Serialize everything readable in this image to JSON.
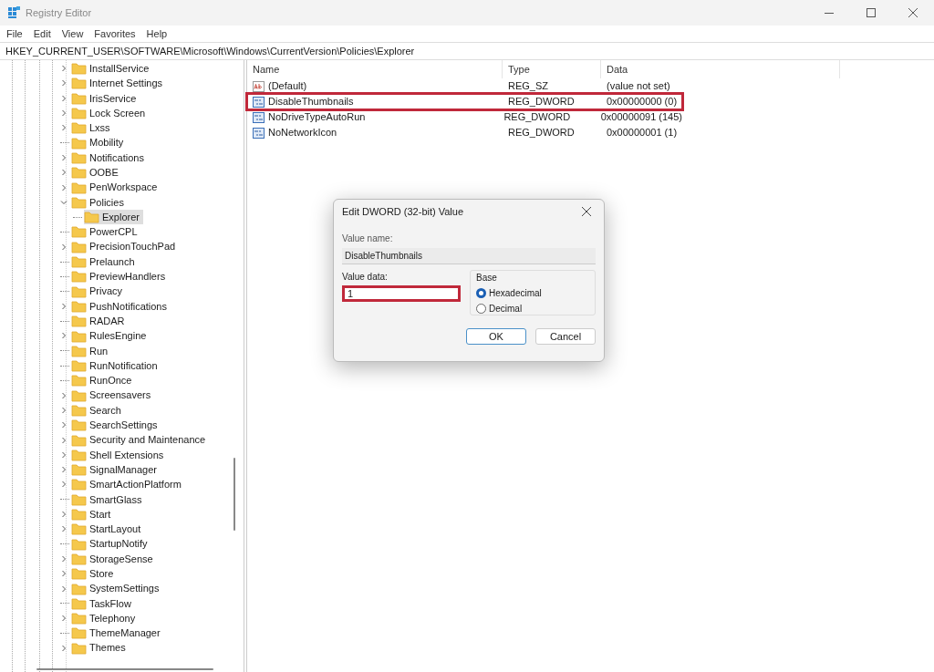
{
  "window": {
    "title": "Registry Editor"
  },
  "menu": [
    "File",
    "Edit",
    "View",
    "Favorites",
    "Help"
  ],
  "address": "HKEY_CURRENT_USER\\SOFTWARE\\Microsoft\\Windows\\CurrentVersion\\Policies\\Explorer",
  "tree": [
    {
      "label": "InstallService",
      "kind": "branch",
      "expanded": false,
      "selected": false
    },
    {
      "label": "Internet Settings",
      "kind": "branch",
      "expanded": false,
      "selected": false
    },
    {
      "label": "IrisService",
      "kind": "branch",
      "expanded": false,
      "selected": false
    },
    {
      "label": "Lock Screen",
      "kind": "branch",
      "expanded": false,
      "selected": false
    },
    {
      "label": "Lxss",
      "kind": "branch",
      "expanded": false,
      "selected": false
    },
    {
      "label": "Mobility",
      "kind": "leaf",
      "selected": false
    },
    {
      "label": "Notifications",
      "kind": "branch",
      "expanded": false,
      "selected": false
    },
    {
      "label": "OOBE",
      "kind": "branch",
      "expanded": false,
      "selected": false
    },
    {
      "label": "PenWorkspace",
      "kind": "branch",
      "expanded": false,
      "selected": false
    },
    {
      "label": "Policies",
      "kind": "branch",
      "expanded": true,
      "selected": false,
      "children": [
        {
          "label": "Explorer",
          "kind": "leaf",
          "selected": true
        }
      ]
    },
    {
      "label": "PowerCPL",
      "kind": "leaf",
      "selected": false
    },
    {
      "label": "PrecisionTouchPad",
      "kind": "branch",
      "expanded": false,
      "selected": false
    },
    {
      "label": "Prelaunch",
      "kind": "leaf",
      "selected": false
    },
    {
      "label": "PreviewHandlers",
      "kind": "leaf",
      "selected": false
    },
    {
      "label": "Privacy",
      "kind": "leaf",
      "selected": false
    },
    {
      "label": "PushNotifications",
      "kind": "branch",
      "expanded": false,
      "selected": false
    },
    {
      "label": "RADAR",
      "kind": "leaf",
      "selected": false
    },
    {
      "label": "RulesEngine",
      "kind": "branch",
      "expanded": false,
      "selected": false
    },
    {
      "label": "Run",
      "kind": "leaf",
      "selected": false
    },
    {
      "label": "RunNotification",
      "kind": "leaf",
      "selected": false
    },
    {
      "label": "RunOnce",
      "kind": "leaf",
      "selected": false
    },
    {
      "label": "Screensavers",
      "kind": "branch",
      "expanded": false,
      "selected": false
    },
    {
      "label": "Search",
      "kind": "branch",
      "expanded": false,
      "selected": false
    },
    {
      "label": "SearchSettings",
      "kind": "branch",
      "expanded": false,
      "selected": false
    },
    {
      "label": "Security and Maintenance",
      "kind": "branch",
      "expanded": false,
      "selected": false
    },
    {
      "label": "Shell Extensions",
      "kind": "branch",
      "expanded": false,
      "selected": false
    },
    {
      "label": "SignalManager",
      "kind": "branch",
      "expanded": false,
      "selected": false
    },
    {
      "label": "SmartActionPlatform",
      "kind": "branch",
      "expanded": false,
      "selected": false
    },
    {
      "label": "SmartGlass",
      "kind": "leaf",
      "selected": false
    },
    {
      "label": "Start",
      "kind": "branch",
      "expanded": false,
      "selected": false
    },
    {
      "label": "StartLayout",
      "kind": "branch",
      "expanded": false,
      "selected": false
    },
    {
      "label": "StartupNotify",
      "kind": "leaf",
      "selected": false
    },
    {
      "label": "StorageSense",
      "kind": "branch",
      "expanded": false,
      "selected": false
    },
    {
      "label": "Store",
      "kind": "branch",
      "expanded": false,
      "selected": false
    },
    {
      "label": "SystemSettings",
      "kind": "branch",
      "expanded": false,
      "selected": false
    },
    {
      "label": "TaskFlow",
      "kind": "leaf",
      "selected": false
    },
    {
      "label": "Telephony",
      "kind": "branch",
      "expanded": false,
      "selected": false
    },
    {
      "label": "ThemeManager",
      "kind": "leaf",
      "selected": false
    },
    {
      "label": "Themes",
      "kind": "branch",
      "expanded": false,
      "selected": false
    }
  ],
  "table": {
    "columns": [
      "Name",
      "Type",
      "Data"
    ],
    "rows": [
      {
        "kind": "string",
        "name": "(Default)",
        "type": "REG_SZ",
        "data": "(value not set)",
        "highlighted": false
      },
      {
        "kind": "binary",
        "name": "DisableThumbnails",
        "type": "REG_DWORD",
        "data": "0x00000000 (0)",
        "highlighted": true
      },
      {
        "kind": "binary",
        "name": "NoDriveTypeAutoRun",
        "type": "REG_DWORD",
        "data": "0x00000091 (145)",
        "highlighted": false
      },
      {
        "kind": "binary",
        "name": "NoNetworkIcon",
        "type": "REG_DWORD",
        "data": "0x00000001 (1)",
        "highlighted": false
      }
    ]
  },
  "dialog": {
    "title": "Edit DWORD (32-bit) Value",
    "value_name_label": "Value name:",
    "value_name": "DisableThumbnails",
    "value_data_label": "Value data:",
    "value_data": "1",
    "value_data_highlighted": true,
    "base_label": "Base",
    "base_options": [
      {
        "label": "Hexadecimal",
        "selected": true
      },
      {
        "label": "Decimal",
        "selected": false
      }
    ],
    "buttons": [
      {
        "label": "OK",
        "default": true
      },
      {
        "label": "Cancel",
        "default": false
      }
    ]
  }
}
